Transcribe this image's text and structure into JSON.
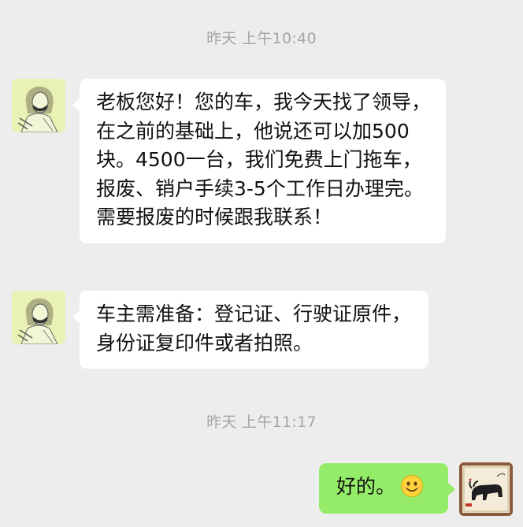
{
  "chat": {
    "timestamps": [
      "昨天 上午10:40",
      "昨天 上午11:17"
    ],
    "messages": [
      {
        "side": "left",
        "text": "老板您好！您的车，我今天找了领导，在之前的基础上，他说还可以加500块。4500一台，我们免费上门拖车，报废、销户手续3-5个工作日办理完。需要报废的时候跟我联系！"
      },
      {
        "side": "left",
        "text": "车主需准备：登记证、行驶证原件，身份证复印件或者拍照。"
      },
      {
        "side": "right",
        "text": "好的。",
        "emoji": "smile-emoji"
      }
    ]
  },
  "colors": {
    "background": "#ededed",
    "incoming_bubble": "#ffffff",
    "outgoing_bubble": "#95ec69",
    "timestamp": "#a5a5a5"
  },
  "icons": {
    "contact_avatar": "contact-avatar-sketch-portrait",
    "self_avatar": "self-avatar-bull-painting"
  }
}
